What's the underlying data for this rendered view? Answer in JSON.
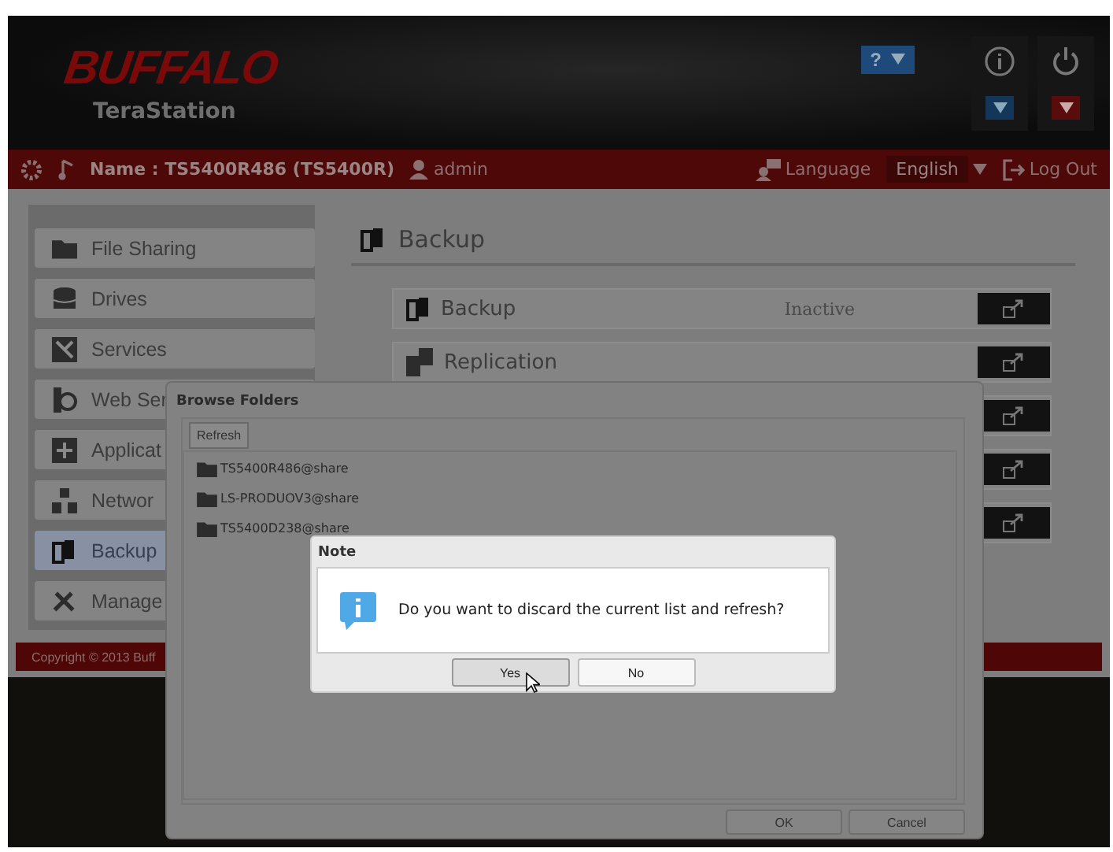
{
  "header": {
    "logo": "BUFFALO",
    "product": "TeraStation",
    "help_button": "?"
  },
  "info_bar": {
    "name": "Name : TS5400R486 (TS5400R)",
    "user": "admin",
    "language_label": "Language",
    "language": "English",
    "logout": "Log Out"
  },
  "sidebar": {
    "items": [
      {
        "label": "File Sharing",
        "kind": "folder",
        "selected": false
      },
      {
        "label": "Drives",
        "kind": "drive",
        "selected": false
      },
      {
        "label": "Services",
        "kind": "services",
        "selected": false
      },
      {
        "label": "Web Ser",
        "kind": "web",
        "selected": false
      },
      {
        "label": "Applicat",
        "kind": "apps",
        "selected": false
      },
      {
        "label": "Networ",
        "kind": "network",
        "selected": false
      },
      {
        "label": "Backup",
        "kind": "backup",
        "selected": true
      },
      {
        "label": "Manage",
        "kind": "manage",
        "selected": false
      }
    ],
    "copyright": "Copyright © 2013 Buff"
  },
  "main": {
    "title": "Backup",
    "rows": [
      {
        "kind": "backup",
        "label": "Backup",
        "status": "Inactive"
      },
      {
        "kind": "replication",
        "label": "Replication"
      },
      {
        "kind": "covered"
      },
      {
        "kind": "covered"
      },
      {
        "kind": "covered"
      }
    ]
  },
  "browse_dialog": {
    "title": "Browse Folders",
    "refresh": "Refresh",
    "folders": [
      "TS5400R486@share",
      "LS-PRODUOV3@share",
      "TS5400D238@share"
    ],
    "buttons": [
      "OK",
      "Cancel"
    ]
  },
  "note_dialog": {
    "title": "Note",
    "message": "Do you want to discard the current list and refresh?",
    "buttons": [
      {
        "label": "Yes",
        "selected": true
      },
      {
        "label": "No",
        "selected": false
      }
    ]
  }
}
